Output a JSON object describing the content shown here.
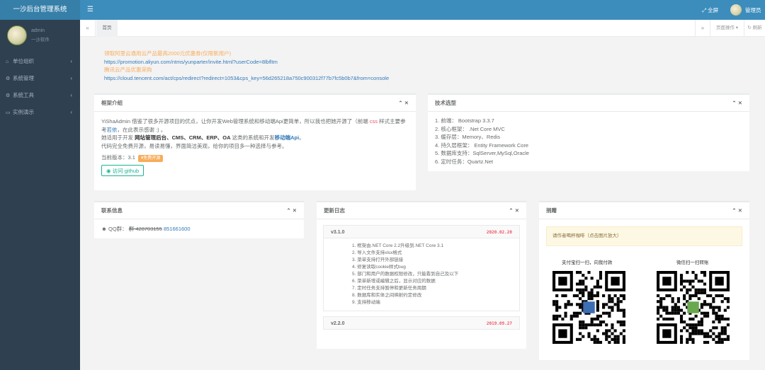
{
  "app": {
    "title": "一沙后台管理系统"
  },
  "user": {
    "name": "admin",
    "subtitle": "一沙软件"
  },
  "sidebar": {
    "items": [
      {
        "label": "单位组织",
        "icon": "home-icon"
      },
      {
        "label": "系统管理",
        "icon": "gear-icon"
      },
      {
        "label": "系统工具",
        "icon": "cogs-icon"
      },
      {
        "label": "实例演示",
        "icon": "desktop-icon"
      }
    ]
  },
  "topbar": {
    "fullscreen_label": "全屏",
    "admin_label": "管理员"
  },
  "tabs": {
    "home": "首页",
    "ops_label": "页面操作",
    "refresh_label": "刷新"
  },
  "promo": {
    "line1": "领取阿里云通用云产品最高2000元优惠券(仅限新用户)",
    "line2": "https://promotion.aliyun.com/ntms/yunparter/invite.html?userCode=8lbfltm",
    "line3": "腾讯云产品优惠采购",
    "line4": "https://cloud.tencent.com/act/cps/redirect?redirect=1053&cps_key=56d265218a750c900312f77b7fc5b0b7&from=console"
  },
  "intro": {
    "title": "框架介绍",
    "p1a": "YiShaAdmin 借鉴了很多开源项目的优点，让你开发Web管理系统和移动端Api更简单，所以我也把她开源了（前端 ",
    "css": "css",
    "p1b": " 样式主要参考",
    "ruoyi": "若依",
    "p1c": "，在此表示感谢 :) 。",
    "p2a": "她适用于开发 ",
    "p2b": "网站管理后台、CMS、CRM、ERP、OA",
    "p2c": " 这类的系统和开发",
    "p2d": "移动端Api",
    "p2e": "。",
    "p3": "代码完全免费开源，易读易懂，界面简洁美观，给你的项目多一种选择与参考。",
    "version_label": "当前版本：3.1",
    "badge": "¥免费开源",
    "github_label": "访问 github"
  },
  "tech": {
    "title": "技术选型",
    "items": [
      "1. 前端： Bootstrap 3.3.7",
      "2. 核心框架： .Net Core MVC",
      "3. 缓存层：Memory、Redis",
      "4. 持久层框架： Entity Framework Core",
      "5. 数据库支持：SqlServer,MySql,Oracle",
      "6. 定时任务：Quartz.Net"
    ]
  },
  "contact": {
    "title": "联系信息",
    "qq_label": "QQ群：",
    "qq_old": "群 428703155",
    "qq_new": "851661600"
  },
  "changelog": {
    "title": "更新日志",
    "versions": [
      {
        "version": "v3.1.0",
        "date": "2020.02.20",
        "items": [
          "1. 框架由.NET Core 2.2升级到.NET Core 3.1",
          "2. 导入文件支持xlsx格式",
          "3. 菜单支持打开外部链接",
          "4. 修复读取cookie样式bug",
          "5. 部门和用户的数据权限修改，只能看到自己及以下",
          "6. 菜单新增或编辑之后，显示对应的数据",
          "7. 定时任务支持暂停和更新任务周期",
          "8. 数据库和实体之间映射约定修改",
          "9. 支持移动端"
        ]
      },
      {
        "version": "v2.2.0",
        "date": "2019.09.27",
        "items": []
      }
    ]
  },
  "donate": {
    "title": "捐赠",
    "notice": "请作者喝杯咖啡（点击图片放大）",
    "alipay_caption": "支付宝扫一扫，向我付款",
    "wechat_caption": "微信扫一扫转账"
  },
  "colors": {
    "sidebar_bg": "#2f4050",
    "topbar_bg": "#3c8dbc",
    "accent_green": "#1ab394",
    "accent_orange": "#f8ac59",
    "link_blue": "#337ab7"
  }
}
